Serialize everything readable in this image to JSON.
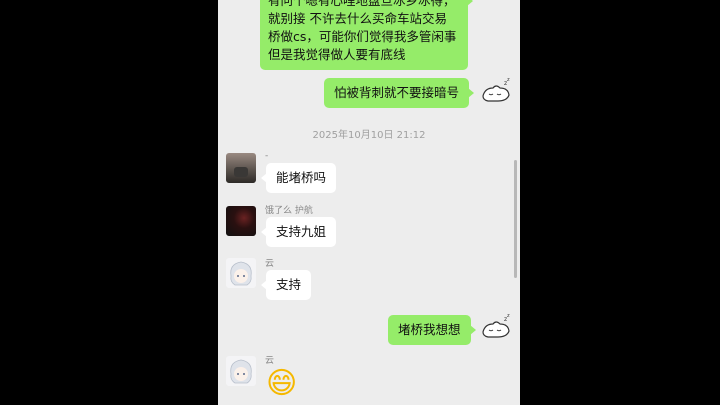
{
  "chat": {
    "top_message_lines": [
      "有问个嗯有心哩地盘旦冰乡冰得，",
      "就别接 不许去什么买命车站交易",
      "桥做cs，可能你们觉得我多管闲事",
      "但是我觉得做人要有底线"
    ],
    "msg_self_1": "怕被背刺就不要接暗号",
    "timestamp": "2025年10月10日 21:12",
    "sender_1": "-",
    "msg_1": "能堵桥吗",
    "sender_2": "饿了么 护航",
    "msg_2": "支持九姐",
    "sender_3": "云",
    "msg_3": "支持",
    "msg_self_2": "堵桥我想想",
    "sender_4": "云",
    "emoji_4": "😄"
  }
}
